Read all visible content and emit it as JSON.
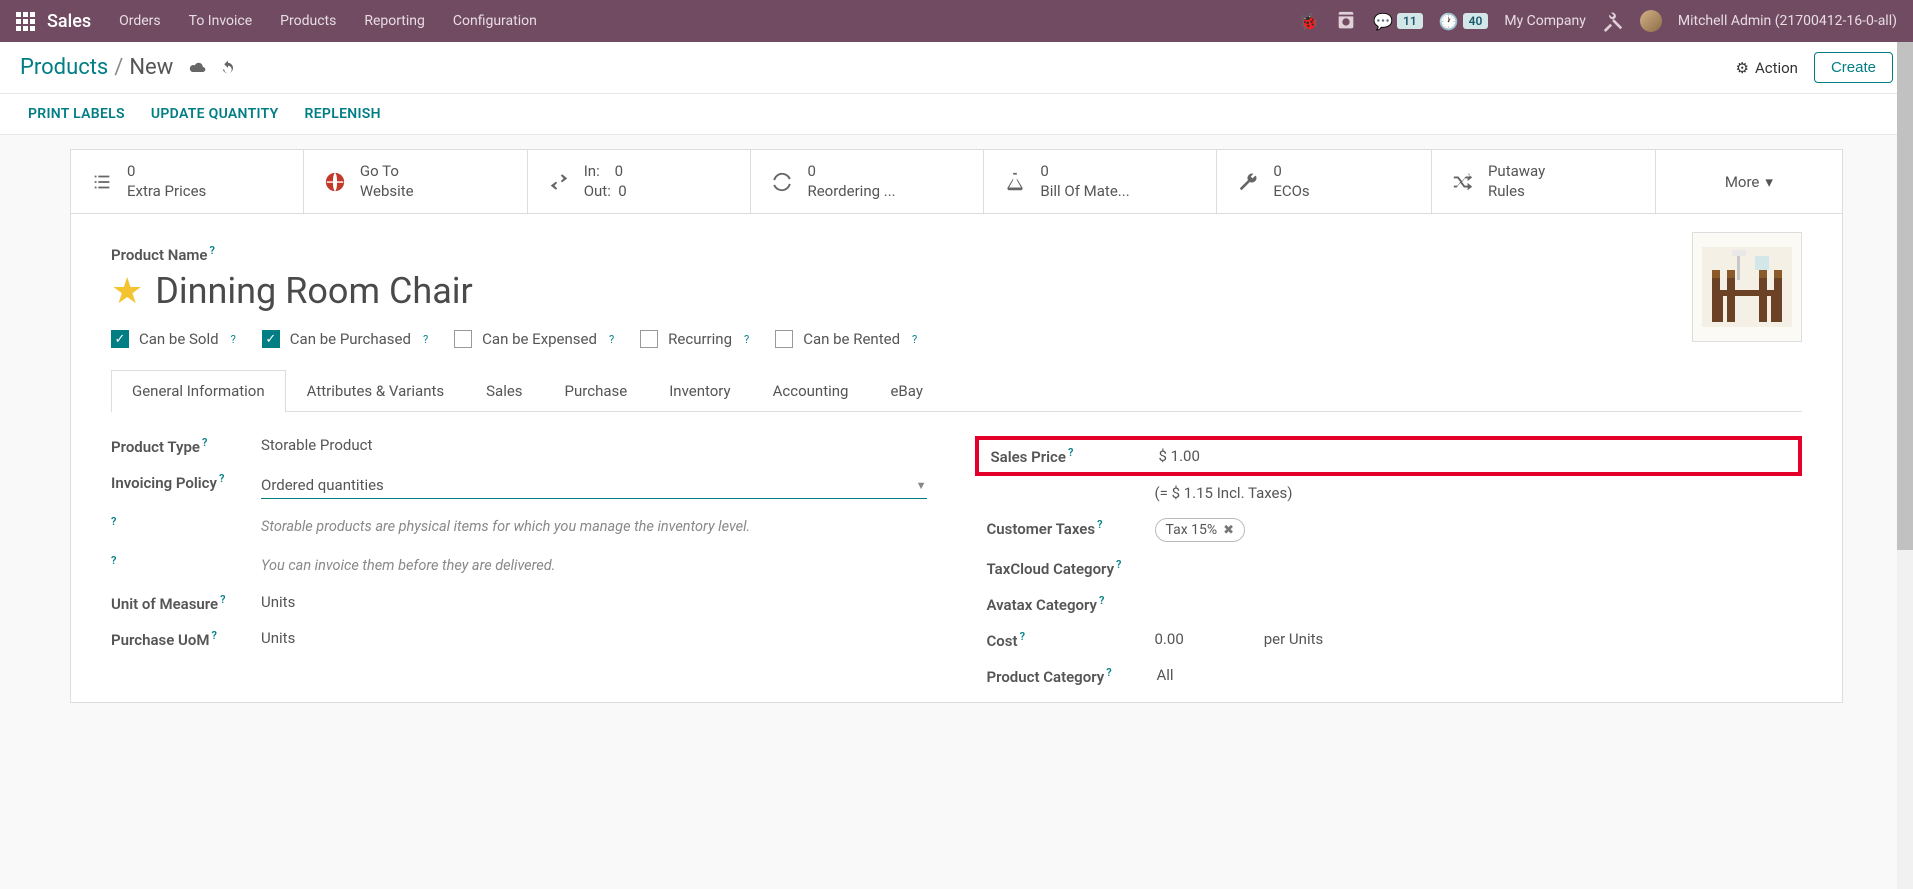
{
  "navbar": {
    "brand": "Sales",
    "menu": [
      "Orders",
      "To Invoice",
      "Products",
      "Reporting",
      "Configuration"
    ],
    "msg_count": "11",
    "timer_count": "40",
    "company": "My Company",
    "user": "Mitchell Admin (21700412-16-0-all)"
  },
  "breadcrumb": {
    "parent": "Products",
    "current": "New",
    "action_label": "Action",
    "create_label": "Create"
  },
  "action_links": [
    "PRINT LABELS",
    "UPDATE QUANTITY",
    "REPLENISH"
  ],
  "stats": [
    {
      "icon": "list",
      "val": "0",
      "lbl": "Extra Prices"
    },
    {
      "icon": "globe",
      "val": "Go To",
      "lbl": "Website"
    },
    {
      "icon": "swap",
      "val": "In:    0",
      "lbl": "Out:  0"
    },
    {
      "icon": "refresh",
      "val": "0",
      "lbl": "Reordering ..."
    },
    {
      "icon": "flask",
      "val": "0",
      "lbl": "Bill Of Mate..."
    },
    {
      "icon": "wrench",
      "val": "0",
      "lbl": "ECOs"
    },
    {
      "icon": "shuffle",
      "val": "Putaway",
      "lbl": "Rules"
    }
  ],
  "more_label": "More",
  "product": {
    "name_label": "Product Name",
    "name": "Dinning Room Chair"
  },
  "checkboxes": [
    {
      "label": "Can be Sold",
      "checked": true
    },
    {
      "label": "Can be Purchased",
      "checked": true
    },
    {
      "label": "Can be Expensed",
      "checked": false
    },
    {
      "label": "Recurring",
      "checked": false
    },
    {
      "label": "Can be Rented",
      "checked": false
    }
  ],
  "tabs": [
    "General Information",
    "Attributes & Variants",
    "Sales",
    "Purchase",
    "Inventory",
    "Accounting",
    "eBay"
  ],
  "left_fields": {
    "product_type_label": "Product Type",
    "product_type": "Storable Product",
    "invoicing_label": "Invoicing Policy",
    "invoicing": "Ordered quantities",
    "hint1": "Storable products are physical items for which you manage the inventory level.",
    "hint2": "You can invoice them before they are delivered.",
    "uom_label": "Unit of Measure",
    "uom": "Units",
    "puom_label": "Purchase UoM",
    "puom": "Units"
  },
  "right_fields": {
    "sales_price_label": "Sales Price",
    "sales_price": "$ 1.00",
    "incl_tax": "(= $  1.15 Incl. Taxes)",
    "customer_taxes_label": "Customer Taxes",
    "tax_tag": "Tax 15%",
    "taxcloud_label": "TaxCloud Category",
    "avatax_label": "Avatax Category",
    "cost_label": "Cost",
    "cost": "0.00",
    "cost_unit": "per Units",
    "category_label": "Product Category",
    "category": "All"
  }
}
